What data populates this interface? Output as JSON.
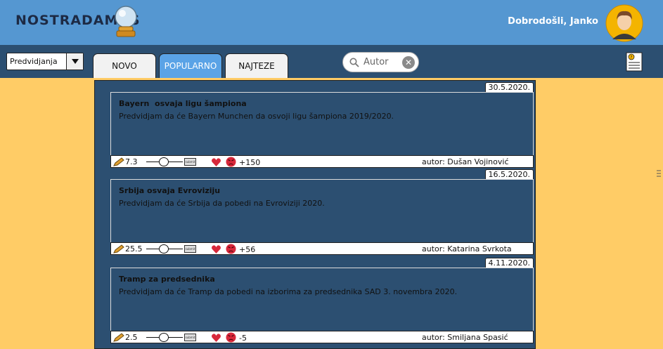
{
  "app": {
    "brand": "NOSTRADAMUS",
    "welcome": "Dobrodošli, Janko"
  },
  "nav": {
    "select_value": "Predvidjanja",
    "tabs": [
      {
        "label": "NOVO",
        "active": false
      },
      {
        "label": "POPULARNO",
        "active": true
      },
      {
        "label": "NAJTEZE",
        "active": false
      }
    ],
    "search_placeholder": "Autor"
  },
  "posts": [
    {
      "date": "30.5.2020.",
      "title": "Bayern  osvaja ligu šampiona",
      "text": "Predvidjam da će Bayern Munchen da osvoji ligu šampiona 2019/2020.",
      "score": "7.3",
      "votes": "+150",
      "author": "autor: Dušan Vojinović"
    },
    {
      "date": "16.5.2020.",
      "title": "Srbija osvaja Evroviziju",
      "text": "Predvidjam da će Srbija da pobedi na Evroviziji 2020.",
      "score": "25.5",
      "votes": "+56",
      "author": "autor: Katarina Svrkota"
    },
    {
      "date": "4.11.2020.",
      "title": "Tramp za predsednika",
      "text": "Predvidjam da će Tramp da pobedi na izborima za predsednika SAD 3. novembra 2020.",
      "score": "2.5",
      "votes": "-5",
      "author": "autor: Smiljana Spasić"
    }
  ],
  "colors": {
    "header": "#5597d1",
    "navbar": "#2c4f71",
    "background": "#ffcc66",
    "active_tab": "#5aa3e6"
  }
}
